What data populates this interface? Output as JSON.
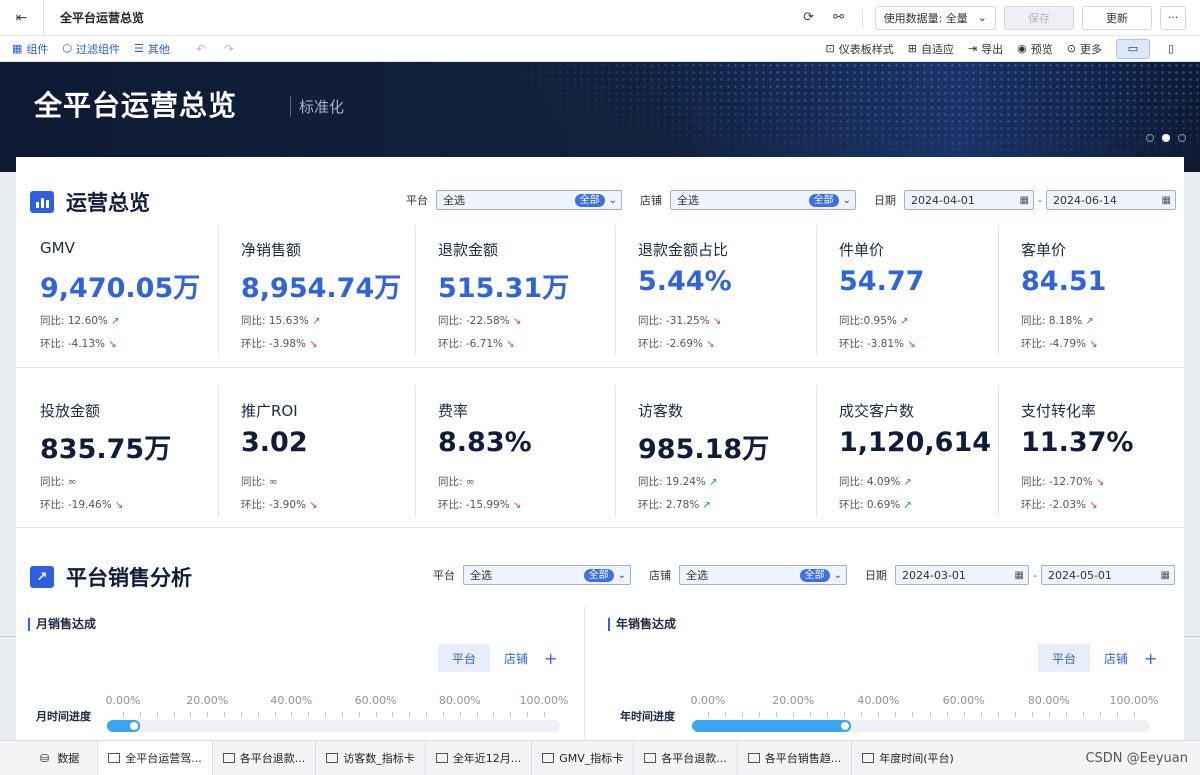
{
  "topbar": {
    "title": "全平台运营总览",
    "data_label": "使用数据量: 全量",
    "save": "保存",
    "update": "更新",
    "more": "···"
  },
  "toolbar": {
    "left": [
      "组件",
      "过滤组件",
      "其他"
    ],
    "right": [
      "仪表板样式",
      "自适应",
      "导出",
      "预览",
      "更多"
    ]
  },
  "banner": {
    "title": "全平台运营总览",
    "subtitle": "标准化"
  },
  "overview": {
    "title": "运营总览",
    "filters": {
      "platform_label": "平台",
      "platform_value": "全选",
      "platform_tag": "全部",
      "store_label": "店铺",
      "store_value": "全选",
      "store_tag": "全部",
      "date_label": "日期",
      "date_from": "2024-04-01",
      "date_to": "2024-06-14"
    },
    "kpis": [
      {
        "label": "GMV",
        "value": "9,470.05万",
        "yoy": "同比: 12.60%",
        "yoy_dir": "up",
        "mom": "环比: -4.13%",
        "mom_dir": "down"
      },
      {
        "label": "净销售额",
        "value": "8,954.74万",
        "yoy": "同比: 15.63%",
        "yoy_dir": "up",
        "mom": "环比: -3.98%",
        "mom_dir": "down"
      },
      {
        "label": "退款金额",
        "value": "515.31万",
        "yoy": "同比: -22.58%",
        "yoy_dir": "down",
        "mom": "环比: -6.71%",
        "mom_dir": "down"
      },
      {
        "label": "退款金额占比",
        "value": "5.44%",
        "yoy": "同比: -31.25%",
        "yoy_dir": "down",
        "mom": "环比: -2.69%",
        "mom_dir": "down"
      },
      {
        "label": "件单价",
        "value": "54.77",
        "yoy": "同比:0.95%",
        "yoy_dir": "up",
        "mom": "环比: -3.81%",
        "mom_dir": "down"
      },
      {
        "label": "客单价",
        "value": "84.51",
        "yoy": "同比: 8.18%",
        "yoy_dir": "up",
        "mom": "环比: -4.79%",
        "mom_dir": "down"
      },
      {
        "label": "投放金额",
        "value": "835.75万",
        "yoy": "同比: ∞",
        "yoy_dir": "",
        "mom": "环比: -19.46%",
        "mom_dir": "down"
      },
      {
        "label": "推广ROI",
        "value": "3.02",
        "yoy": "同比: ∞",
        "yoy_dir": "",
        "mom": "环比: -3.90%",
        "mom_dir": "down"
      },
      {
        "label": "费率",
        "value": "8.83%",
        "yoy": "同比: ∞",
        "yoy_dir": "",
        "mom": "环比: -15.99%",
        "mom_dir": "down"
      },
      {
        "label": "访客数",
        "value": "985.18万",
        "yoy": "同比: 19.24%",
        "yoy_dir": "up",
        "mom": "环比: 2.78%",
        "mom_dir": "up"
      },
      {
        "label": "成交客户数",
        "value": "1,120,614",
        "yoy": "同比: 4.09%",
        "yoy_dir": "up",
        "mom": "环比: 0.69%",
        "mom_dir": "up"
      },
      {
        "label": "支付转化率",
        "value": "11.37%",
        "yoy": "同比: -12.70%",
        "yoy_dir": "down",
        "mom": "环比: -2.03%",
        "mom_dir": "down"
      }
    ]
  },
  "sales": {
    "title": "平台销售分析",
    "filters": {
      "platform_label": "平台",
      "platform_value": "全选",
      "platform_tag": "全部",
      "store_label": "店铺",
      "store_value": "全选",
      "store_tag": "全部",
      "date_label": "日期",
      "date_from": "2024-03-01",
      "date_to": "2024-05-01"
    },
    "monthly": {
      "title": "月销售达成",
      "seg_a": "平台",
      "seg_b": "店铺",
      "plus": "+",
      "progress_label": "月时间进度",
      "ticks": [
        "0.00%",
        "20.00%",
        "40.00%",
        "60.00%",
        "80.00%",
        "100.00%"
      ],
      "progress": 0.04
    },
    "yearly": {
      "title": "年销售达成",
      "seg_a": "平台",
      "seg_b": "店铺",
      "plus": "+",
      "progress_label": "年时间进度",
      "ticks": [
        "0.00%",
        "20.00%",
        "40.00%",
        "60.00%",
        "80.00%",
        "100.00%"
      ],
      "progress": 0.335
    }
  },
  "tabs": {
    "data": "数据",
    "items": [
      "全平台运营驾...",
      "各平台退款...",
      "访客数_指标卡",
      "全年近12月...",
      "GMV_指标卡",
      "各平台退款...",
      "各平台销售趋...",
      "年度时间(平台)"
    ]
  },
  "watermark": "CSDN @Eeyuan",
  "colors": {
    "accent": "#2f63e0",
    "up": "#17a34a",
    "down": "#e23c3c",
    "progress": "#3aa6ee"
  }
}
